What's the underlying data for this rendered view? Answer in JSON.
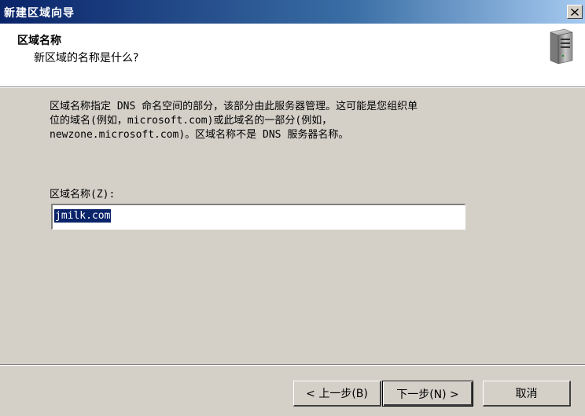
{
  "window": {
    "title": "新建区域向导"
  },
  "header": {
    "title": "区域名称",
    "subtitle": "新区域的名称是什么?",
    "icon": "server-icon"
  },
  "body": {
    "description_lines": [
      "区域名称指定 DNS 命名空间的部分，该部分由此服务器管理。这可能是您组织单",
      "位的域名(例如，microsoft.com)或此域名的一部分(例如，",
      "newzone.microsoft.com)。区域名称不是 DNS 服务器名称。"
    ],
    "zone_name_label": "区域名称(Z):",
    "zone_name_value": "jmilk.com"
  },
  "buttons": {
    "back": "< 上一步(B)",
    "next": "下一步(N) >",
    "cancel": "取消"
  },
  "colors": {
    "titlebar_start": "#0a246a",
    "titlebar_end": "#a6caf0",
    "dialog_bg": "#d4d0c8",
    "selection": "#0a246a"
  }
}
